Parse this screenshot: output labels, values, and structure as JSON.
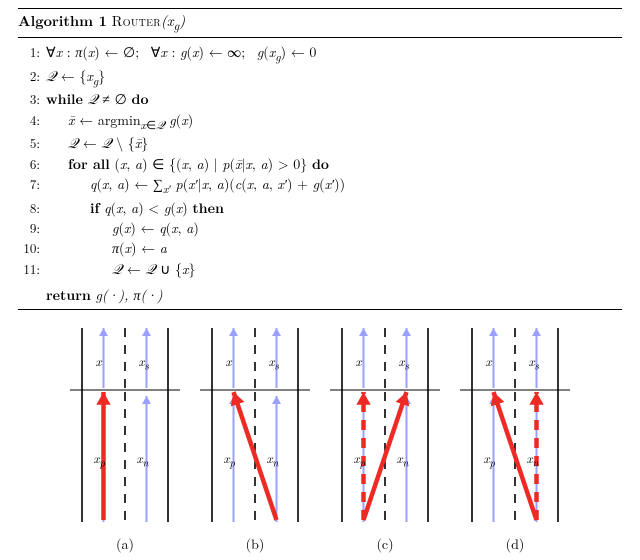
{
  "algorithm": {
    "number": "1",
    "name": "Router",
    "arg": "(x_g)",
    "lines": [
      {
        "n": "1:",
        "indent": 0,
        "html": "∀<span class='math'>x</span> : <span class='math'>π</span>(<span class='math'>x</span>) ← ∅;&nbsp; ∀<span class='math'>x</span> : <span class='math'>g</span>(<span class='math'>x</span>) ← ∞;&nbsp; <span class='math'>g</span>(<span class='math'>x<sub>g</sub></span>) ← 0"
      },
      {
        "n": "2:",
        "indent": 0,
        "html": "<span class='math'>𝒬</span> ← {<span class='math'>x<sub>g</sub></span>}"
      },
      {
        "n": "3:",
        "indent": 0,
        "html": "<span class='kw'>while</span> <span class='math'>𝒬</span> ≠ ∅ <span class='kw'>do</span>"
      },
      {
        "n": "4:",
        "indent": 1,
        "html": "<span class='math'>x̄</span> ← argmin<sub><span class='math'>x</span>∈<span class='math'>𝒬</span></sub> <span class='math'>g</span>(<span class='math'>x</span>)"
      },
      {
        "n": "5:",
        "indent": 1,
        "html": "<span class='math'>𝒬</span> ← <span class='math'>𝒬</span> \\ {<span class='math'>x̄</span>}"
      },
      {
        "n": "6:",
        "indent": 1,
        "html": "<span class='kw'>for all</span> (<span class='math'>x</span>, <span class='math'>a</span>) ∈ {(<span class='math'>x</span>, <span class='math'>a</span>) | <span class='math'>p</span>(<span class='math'>x̄</span>|<span class='math'>x</span>, <span class='math'>a</span>) &gt; 0} <span class='kw'>do</span>"
      },
      {
        "n": "7:",
        "indent": 2,
        "html": "<span class='math'>q</span>(<span class='math'>x</span>, <span class='math'>a</span>) ← ∑<sub><span class='math'>x′</span></sub> <span class='math'>p</span>(<span class='math'>x′</span>|<span class='math'>x</span>, <span class='math'>a</span>)(<span class='math'>c</span>(<span class='math'>x</span>, <span class='math'>a</span>, <span class='math'>x′</span>) + <span class='math'>g</span>(<span class='math'>x′</span>))"
      },
      {
        "n": "8:",
        "indent": 2,
        "html": "<span class='kw'>if</span> <span class='math'>q</span>(<span class='math'>x</span>, <span class='math'>a</span>) &lt; <span class='math'>g</span>(<span class='math'>x</span>) <span class='kw'>then</span>"
      },
      {
        "n": "9:",
        "indent": 3,
        "html": "<span class='math'>g</span>(<span class='math'>x</span>) ← <span class='math'>q</span>(<span class='math'>x</span>, <span class='math'>a</span>)"
      },
      {
        "n": "10:",
        "indent": 3,
        "html": "<span class='math'>π</span>(<span class='math'>x</span>) ← <span class='math'>a</span>"
      },
      {
        "n": "11:",
        "indent": 3,
        "html": "<span class='math'>𝒬</span> ← <span class='math'>𝒬</span> ∪ {<span class='math'>x</span>}"
      }
    ],
    "return": "g(·), π(·)"
  },
  "figure": {
    "labels": {
      "x": "x",
      "xs": "x_s",
      "xp": "x_p",
      "xn": "x_n"
    },
    "panels": [
      {
        "caption": "(a)"
      },
      {
        "caption": "(b)"
      },
      {
        "caption": "(c)"
      },
      {
        "caption": "(d)"
      }
    ]
  },
  "colors": {
    "arrow_thin": "#9aa0ff",
    "arrow_bold": "#ee2a24",
    "lane": "#000"
  },
  "chart_data": {
    "type": "table",
    "description": "Four lane-change diagrams. Two lanes with prior node x_p (left lane) and neighbor x_n (right lane) below, and current node x (left) and successor x_s (right) above. Thin violet arrows show forward traffic in each lane. Thick red arrows show allowed transitions from bottom nodes to top nodes; dashed red = alternative/secondary.",
    "nodes": [
      "x",
      "x_s",
      "x_p",
      "x_n"
    ],
    "lane_of": {
      "x": "left",
      "x_s": "right",
      "x_p": "left",
      "x_n": "right"
    },
    "panels": [
      {
        "id": "a",
        "red_edges": [
          {
            "from": "x_p",
            "to": "x",
            "style": "solid"
          }
        ]
      },
      {
        "id": "b",
        "red_edges": [
          {
            "from": "x_n",
            "to": "x",
            "style": "solid"
          }
        ]
      },
      {
        "id": "c",
        "red_edges": [
          {
            "from": "x_p",
            "to": "x",
            "style": "dashed"
          },
          {
            "from": "x_p",
            "to": "x_s",
            "style": "solid"
          }
        ]
      },
      {
        "id": "d",
        "red_edges": [
          {
            "from": "x_n",
            "to": "x",
            "style": "solid"
          },
          {
            "from": "x_n",
            "to": "x_s",
            "style": "dashed"
          }
        ]
      }
    ]
  }
}
